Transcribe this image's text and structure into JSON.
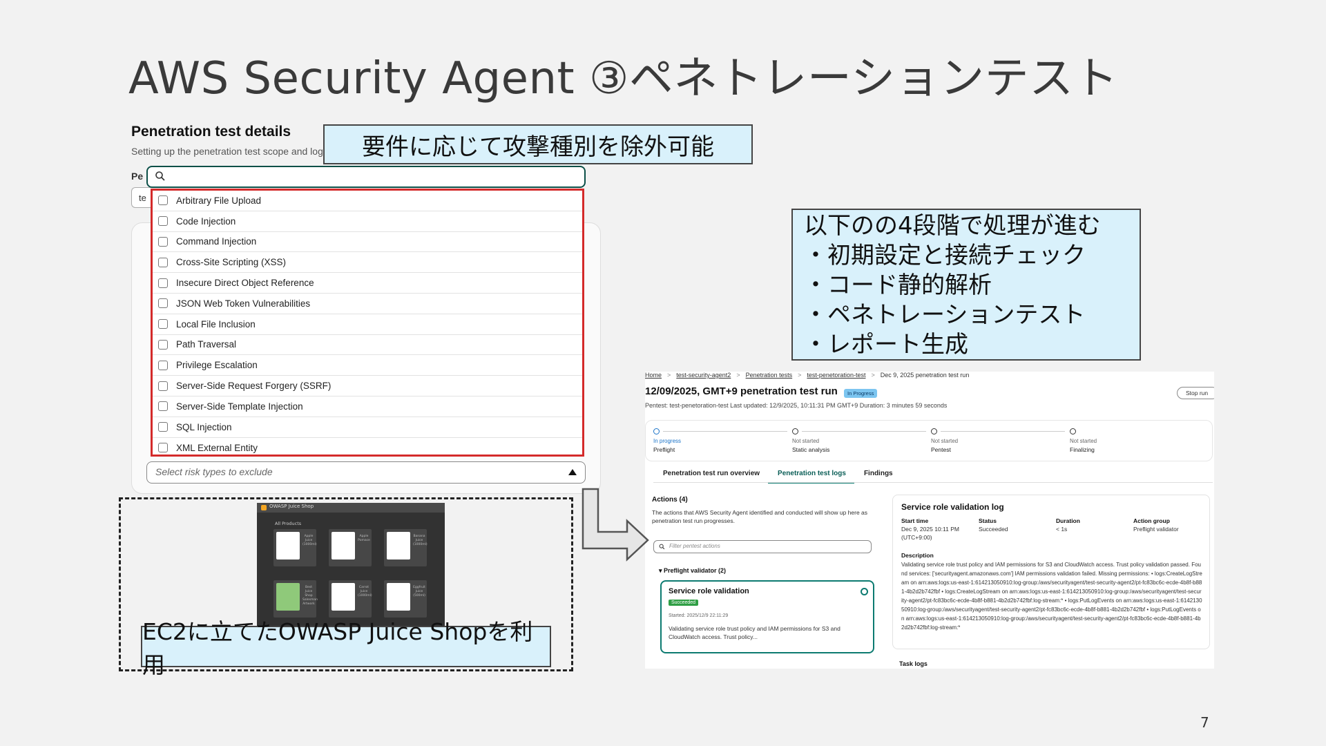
{
  "slide": {
    "title": "AWS Security Agent ③ペネトレーションテスト",
    "page_number": "7"
  },
  "callouts": {
    "exclude": "要件に応じて攻撃種別を除外可能",
    "phases": [
      "以下のの4段階で処理が進む",
      "・初期設定と接続チェック",
      "・コード静的解析",
      "・ペネトレーションテスト",
      "・レポート生成"
    ],
    "juice": "EC2に立てたOWASP Juice Shopを利用"
  },
  "pentest_details": {
    "heading": "Penetration test details",
    "subtitle": "Setting up the penetration test scope and log",
    "peek_label": "Pe",
    "peek_value": "te",
    "search_placeholder": "",
    "risk_types": [
      "Arbitrary File Upload",
      "Code Injection",
      "Command Injection",
      "Cross-Site Scripting (XSS)",
      "Insecure Direct Object Reference",
      "JSON Web Token Vulnerabilities",
      "Local File Inclusion",
      "Path Traversal",
      "Privilege Escalation",
      "Server-Side Request Forgery (SSRF)",
      "Server-Side Template Injection",
      "SQL Injection",
      "XML External Entity"
    ],
    "exclude_placeholder": "Select risk types to exclude"
  },
  "juice_shop": {
    "window_title": "OWASP Juice Shop",
    "section": "All Products",
    "products": [
      "Apple Juice (1000ml)",
      "Apple Pomace",
      "Banana Juice (1000ml)",
      "Best Juice Shop Salesman Artwork",
      "Carrot Juice (1000ml)",
      "Eggfruit Juice (500ml)"
    ]
  },
  "console": {
    "breadcrumb": [
      "Home",
      "test-security-agent2",
      "Penetration tests",
      "test-penetoration-test",
      "Dec 9, 2025 penetration test run"
    ],
    "run_title": "12/09/2025, GMT+9 penetration test run",
    "status_badge": "In Progress",
    "stop_button": "Stop run",
    "meta": "Pentest: test-penetoration-test   Last updated: 12/9/2025, 10:11:31 PM GMT+9   Duration: 3 minutes 59 seconds",
    "steps": [
      {
        "status": "In progress",
        "name": "Preflight"
      },
      {
        "status": "Not started",
        "name": "Static analysis"
      },
      {
        "status": "Not started",
        "name": "Pentest"
      },
      {
        "status": "Not started",
        "name": "Finalizing"
      }
    ],
    "tabs": [
      "Penetration test run overview",
      "Penetration test logs",
      "Findings"
    ],
    "actions_title": "Actions (4)",
    "actions_desc": "The actions that AWS Security Agent identified and conducted will show up here as penetration test run progresses.",
    "filter_placeholder": "Filter pentest actions",
    "group_title": "Preflight validator (2)",
    "action_card": {
      "title": "Service role validation",
      "badge": "Succeeded",
      "started": "Started: 2025/12/9 22:11:29",
      "desc": "Validating service role trust policy and IAM permissions for S3 and CloudWatch access. Trust policy..."
    },
    "log": {
      "title": "Service role validation log",
      "headers": [
        "Start time",
        "Status",
        "Duration",
        "Action group"
      ],
      "values": [
        "Dec 9, 2025 10:11 PM (UTC+9:00)",
        "Succeeded",
        "< 1s",
        "Preflight validator"
      ],
      "desc_label": "Description",
      "desc": "Validating service role trust policy and IAM permissions for S3 and CloudWatch access. Trust policy validation passed. Found services: ['securityagent.amazonaws.com'] IAM permissions validation failed. Missing permissions: • logs:CreateLogStream on arn:aws:logs:us-east-1:614213050910:log-group:/aws/securityagent/test-security-agent2/pt-fc83bc6c-ecde-4b8f-b881-4b2d2b742fbf • logs:CreateLogStream on arn:aws:logs:us-east-1:614213050910:log-group:/aws/securityagent/test-security-agent2/pt-fc83bc6c-ecde-4b8f-b881-4b2d2b742fbf:log-stream:* • logs:PutLogEvents on arn:aws:logs:us-east-1:614213050910:log-group:/aws/securityagent/test-security-agent2/pt-fc83bc6c-ecde-4b8f-b881-4b2d2b742fbf • logs:PutLogEvents on arn:aws:logs:us-east-1:614213050910:log-group:/aws/securityagent/test-security-agent2/pt-fc83bc6c-ecde-4b8f-b881-4b2d2b742fbf:log-stream:*"
    },
    "task_logs": "Task logs"
  }
}
